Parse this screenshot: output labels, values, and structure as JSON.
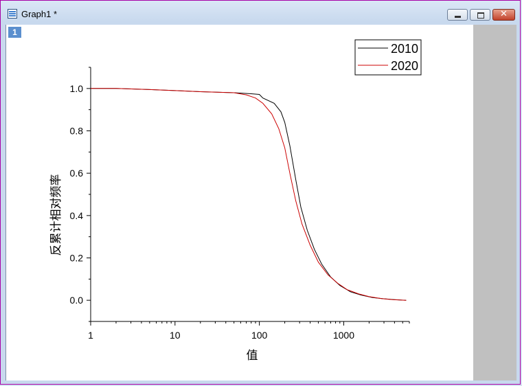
{
  "window": {
    "title": "Graph1 *",
    "layer_number": "1"
  },
  "chart_data": {
    "type": "line",
    "title": "",
    "xlabel": "值",
    "ylabel": "反累计相对频率",
    "xscale": "log",
    "xlim": [
      1,
      6000
    ],
    "ylim": [
      -0.1,
      1.1
    ],
    "x_ticks": [
      1,
      10,
      100,
      1000
    ],
    "x_tick_labels": [
      "1",
      "10",
      "100",
      "1000"
    ],
    "y_ticks": [
      0.0,
      0.2,
      0.4,
      0.6,
      0.8,
      1.0
    ],
    "y_tick_labels": [
      "0.0",
      "0.2",
      "0.4",
      "0.6",
      "0.8",
      "1.0"
    ],
    "grid": false,
    "legend_position": "top-right",
    "series": [
      {
        "name": "2010",
        "color": "#000000",
        "x": [
          1,
          2,
          5,
          10,
          20,
          50,
          80,
          100,
          110,
          150,
          180,
          200,
          230,
          270,
          310,
          370,
          450,
          550,
          700,
          900,
          1200,
          1600,
          2200,
          3000,
          4000,
          5500
        ],
        "y": [
          1.0,
          1.0,
          0.995,
          0.99,
          0.985,
          0.98,
          0.975,
          0.972,
          0.955,
          0.93,
          0.89,
          0.84,
          0.73,
          0.57,
          0.44,
          0.33,
          0.24,
          0.17,
          0.11,
          0.07,
          0.04,
          0.025,
          0.013,
          0.007,
          0.003,
          0.0
        ]
      },
      {
        "name": "2020",
        "color": "#cc0000",
        "x": [
          1,
          2,
          5,
          10,
          20,
          50,
          70,
          90,
          110,
          140,
          170,
          200,
          230,
          270,
          320,
          400,
          500,
          650,
          850,
          1100,
          1500,
          2000,
          2800,
          3800,
          5500
        ],
        "y": [
          1.0,
          1.0,
          0.995,
          0.99,
          0.985,
          0.98,
          0.97,
          0.955,
          0.93,
          0.88,
          0.81,
          0.72,
          0.6,
          0.47,
          0.36,
          0.26,
          0.18,
          0.12,
          0.08,
          0.05,
          0.03,
          0.017,
          0.008,
          0.003,
          0.0
        ]
      }
    ]
  }
}
